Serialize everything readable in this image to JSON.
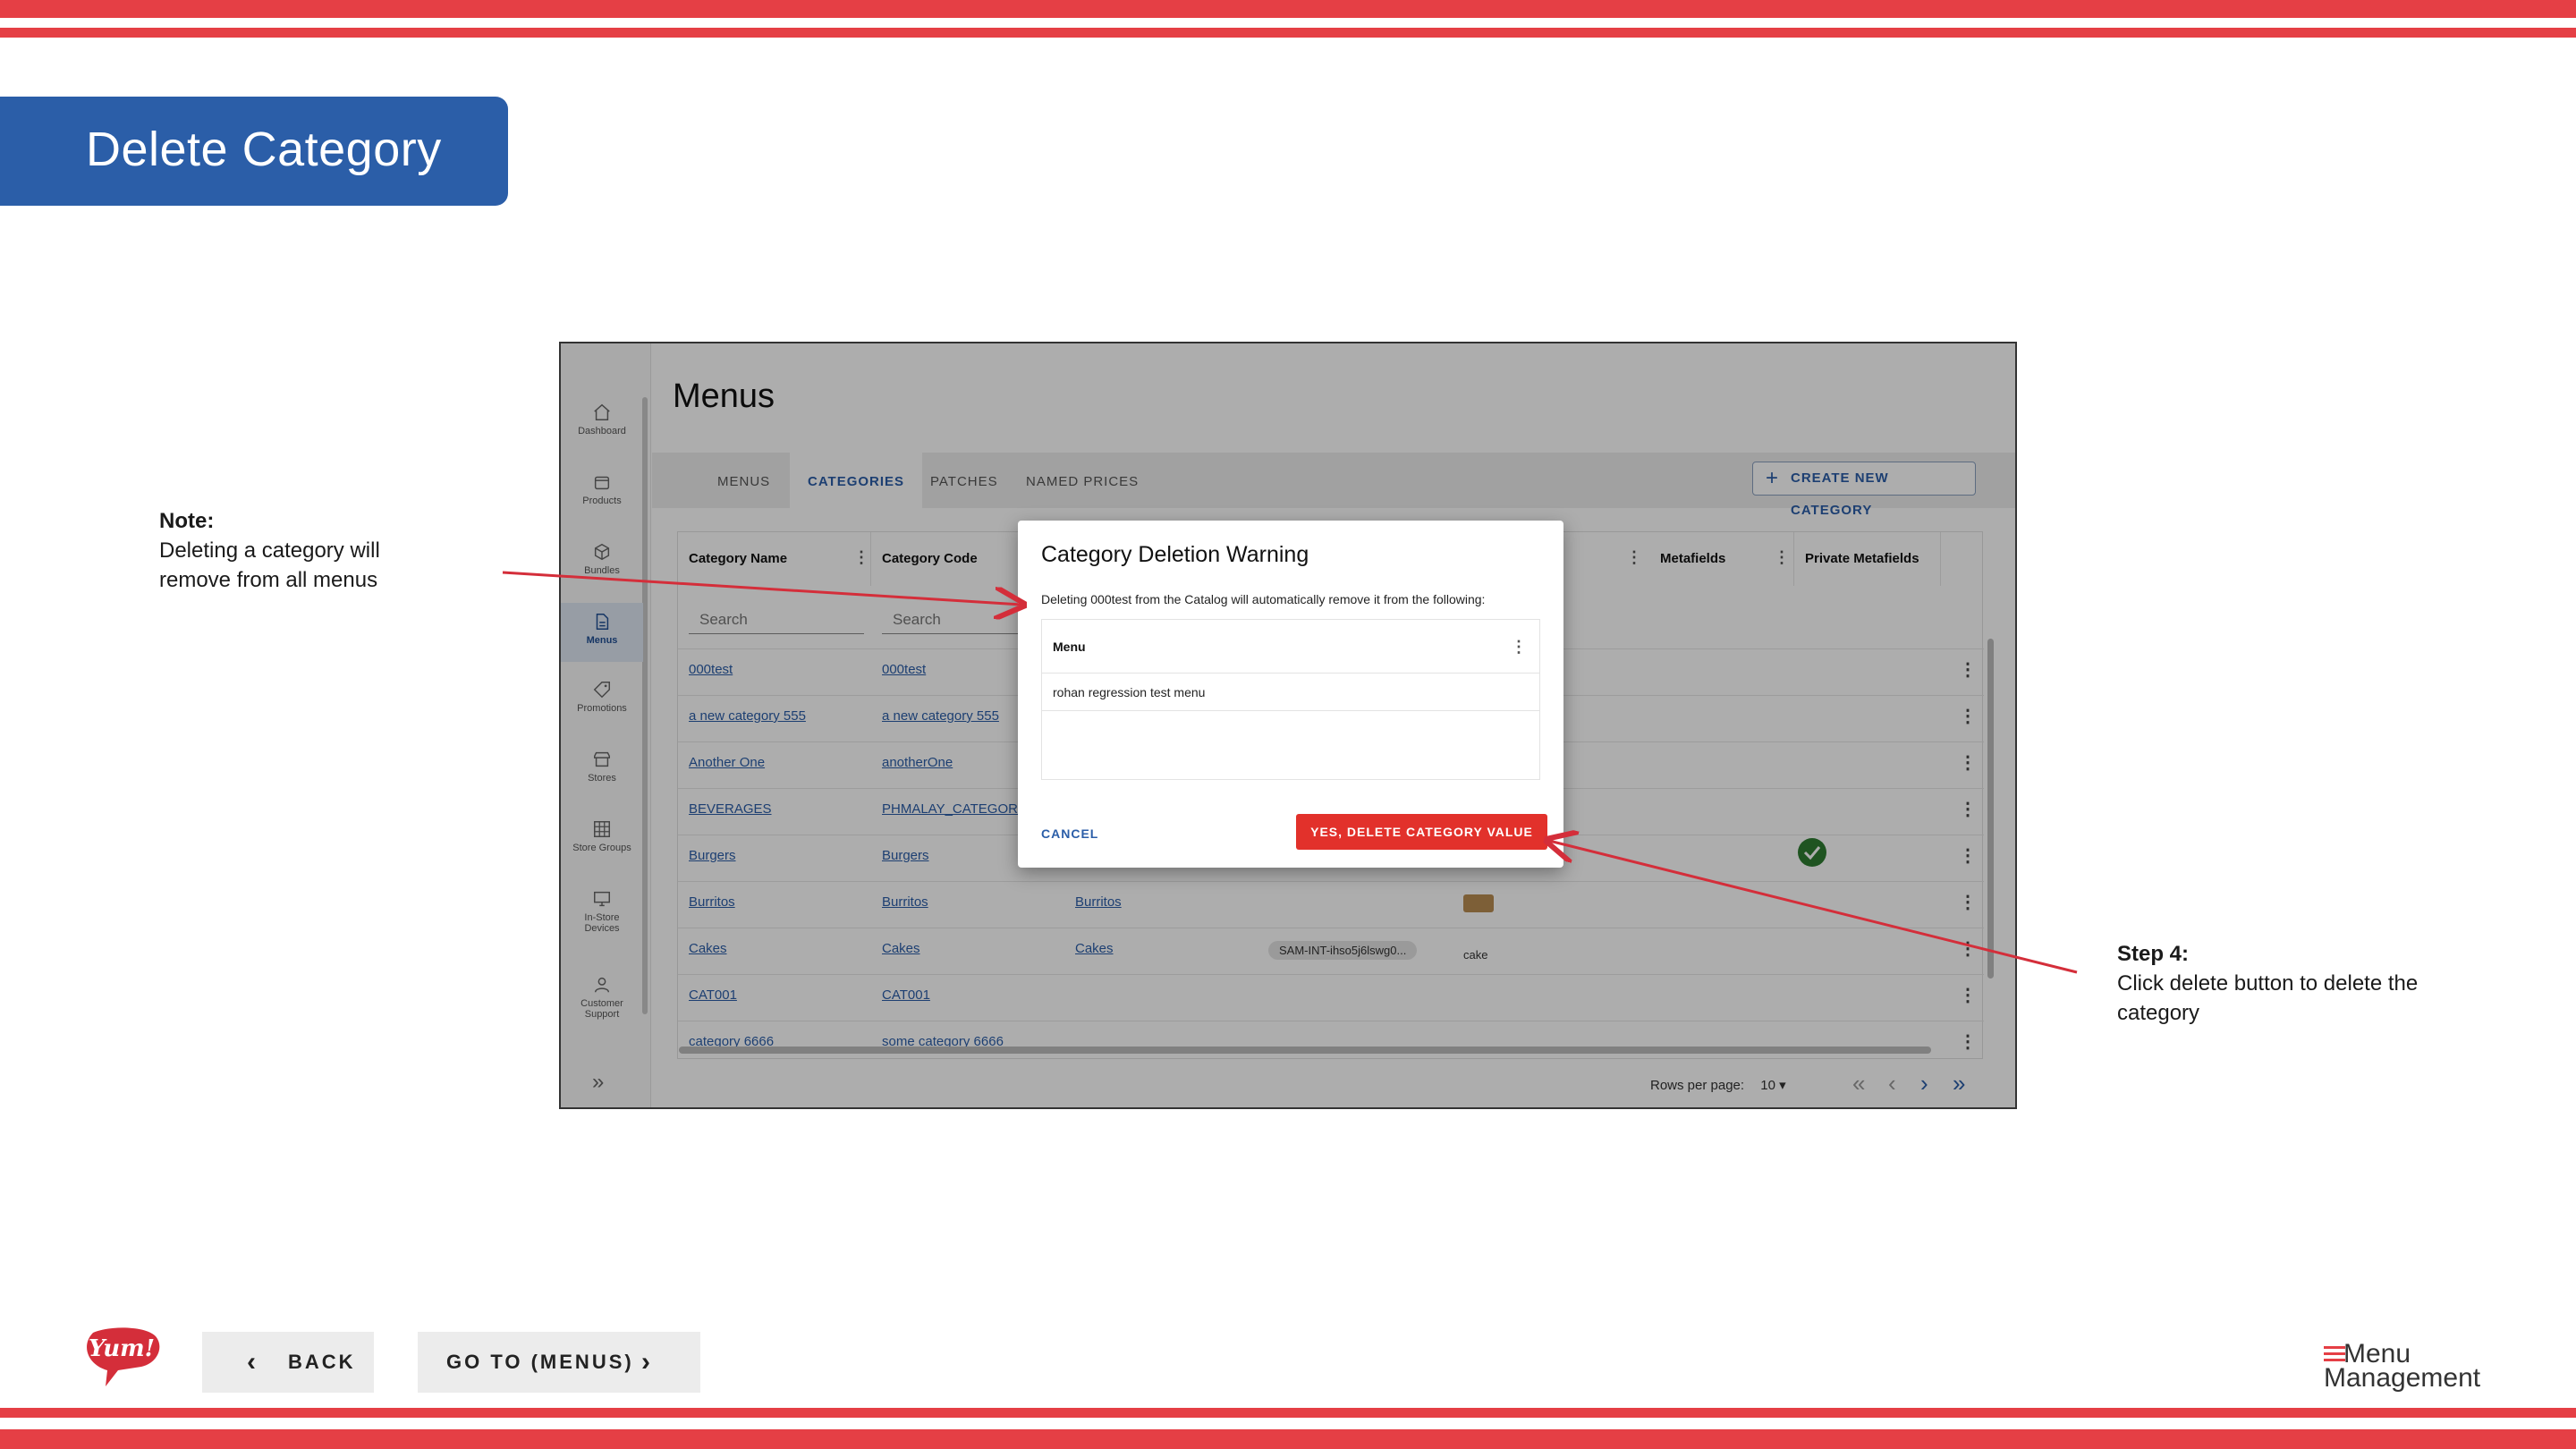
{
  "slide": {
    "title": "Delete Category",
    "note_heading": "Note:",
    "note_line1": "Deleting a category will",
    "note_line2": "remove from all menus",
    "step_heading": "Step 4:",
    "step_line1": "Click delete button to delete the",
    "step_line2": "category",
    "back_label": "BACK",
    "goto_label": "GO TO (MENUS)",
    "logo_left_text": "Yum!",
    "logo_right_line1": "Menu",
    "logo_right_line2": "Management",
    "colors": {
      "stripe": "#e53f45",
      "banner": "#2b5ea8",
      "danger": "#e2312b"
    }
  },
  "app": {
    "title": "Menus",
    "nav": [
      {
        "label": "Dashboard",
        "icon": "home-icon"
      },
      {
        "label": "Products",
        "icon": "box-icon"
      },
      {
        "label": "Bundles",
        "icon": "cube-icon"
      },
      {
        "label": "Menus",
        "icon": "document-icon",
        "active": true
      },
      {
        "label": "Promotions",
        "icon": "tag-icon"
      },
      {
        "label": "Stores",
        "icon": "store-icon"
      },
      {
        "label": "Store Groups",
        "icon": "grid-icon"
      },
      {
        "label": "In-Store",
        "label2": "Devices",
        "icon": "monitor-icon"
      },
      {
        "label": "Customer",
        "label2": "Support",
        "icon": "person-icon"
      }
    ],
    "tabs": [
      "MENUS",
      "CATEGORIES",
      "PATCHES",
      "NAMED PRICES"
    ],
    "active_tab": "CATEGORIES",
    "create_button": "CREATE NEW CATEGORY",
    "columns": [
      "Category Name",
      "Category Code",
      "Metafields",
      "Private Metafields"
    ],
    "search_placeholder": "Search",
    "rows": [
      {
        "name": "000test",
        "code": "000test"
      },
      {
        "name": "a new category 555",
        "code": "a new category 555"
      },
      {
        "name": "Another One",
        "code": "anotherOne"
      },
      {
        "name": "BEVERAGES",
        "code": "PHMALAY_CATEGORY"
      },
      {
        "name": "Burgers",
        "code": "Burgers"
      },
      {
        "name": "Burritos",
        "code": "Burritos",
        "extra": "Burritos"
      },
      {
        "name": "Cakes",
        "code": "Cakes",
        "extra": "Cakes",
        "chip": "SAM-INT-ihso5j6lswg0...",
        "img_alt": "cake"
      },
      {
        "name": "CAT001",
        "code": "CAT001"
      },
      {
        "name": "category 6666",
        "code": "some category 6666"
      }
    ],
    "rows_per_page_label": "Rows per page:",
    "rows_per_page_value": "10"
  },
  "dialog": {
    "title": "Category Deletion Warning",
    "message": "Deleting 000test from the Catalog will automatically remove it from the following:",
    "table_header": "Menu",
    "table_rows": [
      "rohan regression test menu"
    ],
    "cancel_label": "CANCEL",
    "confirm_label": "YES, DELETE CATEGORY VALUE"
  }
}
